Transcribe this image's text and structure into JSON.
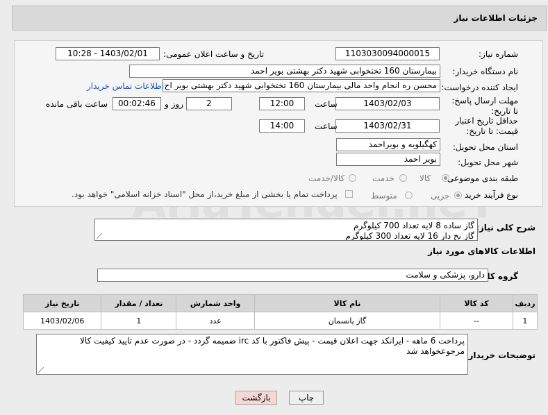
{
  "header": {
    "title": "جزئیات اطلاعات نیاز"
  },
  "fields": {
    "need_number_label": "شماره نیاز:",
    "need_number": "1103030094000015",
    "announce_label": "تاریخ و ساعت اعلان عمومی:",
    "announce_value": "1403/02/01 - 10:28",
    "buyer_org_label": "نام دستگاه خریدار:",
    "buyer_org": "بیمارستان 160 تختخوابی شهید دکتر بهشتی بویر احمد",
    "creator_label": "ایجاد کننده درخواست:",
    "creator": "محسن ره انجام واحد مالی بیمارستان 160 تختخوابی شهید دکتر بهشتی بویر اح",
    "contact_link": "اطلاعات تماس خریدار",
    "deadline_label": "مهلت ارسال پاسخ: تا تاریخ:",
    "deadline_date": "1403/02/03",
    "time_label": "ساعت",
    "deadline_time": "12:00",
    "days_value": "2",
    "days_label": "روز و",
    "remaining_value": "00:02:46",
    "remaining_label": "ساعت باقی مانده",
    "validity_label": "حداقل تاریخ اعتبار قیمت: تا تاریخ:",
    "validity_date": "1403/02/31",
    "validity_time": "14:00",
    "province_label": "استان محل تحویل:",
    "province": "کهگیلویه و بویراحمد",
    "city_label": "شهر محل تحویل:",
    "city": "بویر احمد",
    "category_label": "طبقه بندی موضوعی:",
    "category_options": [
      "کالا",
      "خدمت",
      "کالا/خدمت"
    ],
    "purchase_label": "نوع فرآیند خرید :",
    "purchase_options": [
      "جزیی",
      "متوسط"
    ],
    "treasury_note": "پرداخت تمام یا بخشی از مبلغ خرید،از محل \"اسناد خزانه اسلامی\" خواهد بود."
  },
  "description": {
    "label": "شرح کلی نیاز:",
    "lines": [
      "گاز ساده 8 لایه تعداد 700 کیلوگرم",
      "گاز نخ دار 16 لایه تعداد 300 کیلوگرم"
    ]
  },
  "goods_section": {
    "title": "اطلاعات کالاهای مورد نیاز",
    "group_label": "گروه کالا:",
    "group_value": "دارو، پزشکی و سلامت"
  },
  "table": {
    "headers": [
      "ردیف",
      "کد کالا",
      "نام کالا",
      "واحد شمارش",
      "تعداد / مقدار",
      "تاریخ نیاز"
    ],
    "rows": [
      [
        "1",
        "--",
        "گاز پانسمان",
        "عدد",
        "1",
        "1403/02/06"
      ]
    ]
  },
  "buyer_notes": {
    "label": "توضیحات خریدار:",
    "text": "پرداخت 6 ماهه - ایرانکد جهت اعلان قیمت - پیش فاکتور با کد irc ضمیمه گردد - در صورت عدم تایید کیفیت کالا مرجوعخواهد شد"
  },
  "buttons": {
    "print": "چاپ",
    "back": "بازگشت"
  },
  "watermark": "AriaTender.neT",
  "colors": {
    "link": "#1b52b3",
    "back_button_bg": "#f6d7d7",
    "header_bg": "#d9d9d9"
  }
}
